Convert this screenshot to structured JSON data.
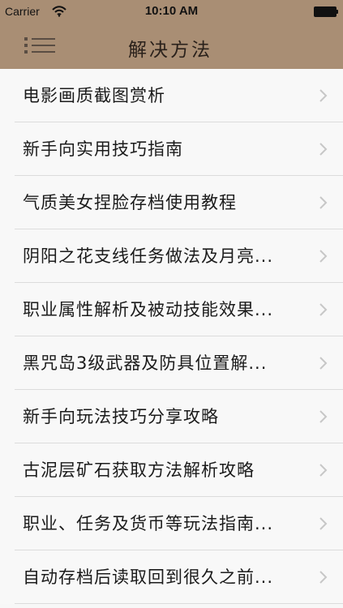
{
  "status_bar": {
    "carrier": "Carrier",
    "time": "10:10 AM",
    "wifi_icon": "wifi-icon",
    "battery_icon": "battery-icon"
  },
  "navigation": {
    "title": "解决方法",
    "menu_icon": "menu-icon"
  },
  "colors": {
    "header_background": "#a98e74",
    "list_background": "#f7f7f7",
    "separator": "#dcdcdc",
    "text": "#1b1b1b",
    "chevron": "#c7c7c7"
  },
  "list": {
    "items": [
      {
        "label": "电影画质截图赏析",
        "icon": "chevron-right-icon"
      },
      {
        "label": "新手向实用技巧指南",
        "icon": "chevron-right-icon"
      },
      {
        "label": "气质美女捏脸存档使用教程",
        "icon": "chevron-right-icon"
      },
      {
        "label": "阴阳之花支线任务做法及月亮...",
        "icon": "chevron-right-icon"
      },
      {
        "label": "职业属性解析及被动技能效果...",
        "icon": "chevron-right-icon"
      },
      {
        "label": "黑咒岛3级武器及防具位置解...",
        "icon": "chevron-right-icon"
      },
      {
        "label": "新手向玩法技巧分享攻略",
        "icon": "chevron-right-icon"
      },
      {
        "label": "古泥层矿石获取方法解析攻略",
        "icon": "chevron-right-icon"
      },
      {
        "label": "职业、任务及货币等玩法指南...",
        "icon": "chevron-right-icon"
      },
      {
        "label": "自动存档后读取回到很久之前...",
        "icon": "chevron-right-icon"
      }
    ]
  }
}
